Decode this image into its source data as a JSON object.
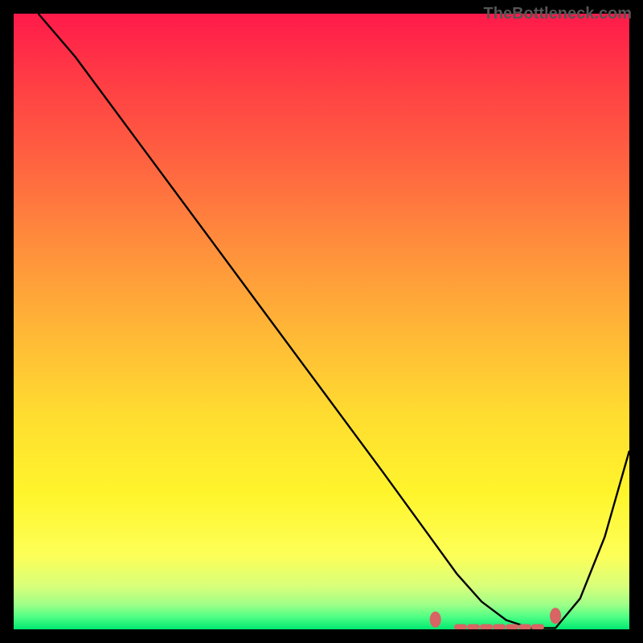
{
  "watermark": "TheBottleneck.com",
  "chart_data": {
    "type": "line",
    "title": "",
    "xlabel": "",
    "ylabel": "",
    "xlim": [
      0,
      100
    ],
    "ylim": [
      0,
      100
    ],
    "series": [
      {
        "name": "curve",
        "type": "line",
        "stroke": "#000000",
        "x": [
          4,
          10,
          20,
          30,
          40,
          50,
          60,
          64,
          68,
          72,
          76,
          80,
          84,
          88,
          92,
          96,
          100
        ],
        "values": [
          100,
          93,
          79.5,
          66,
          52.5,
          39,
          25.5,
          20,
          14.5,
          9,
          4.5,
          1.5,
          0.2,
          0.2,
          5,
          15,
          29
        ]
      },
      {
        "name": "markers-left",
        "type": "scatter",
        "color": "#d86464",
        "x": [
          68.5
        ],
        "values": [
          1.6
        ]
      },
      {
        "name": "markers-right",
        "type": "scatter",
        "color": "#d86464",
        "x": [
          88.0
        ],
        "values": [
          2.2
        ]
      },
      {
        "name": "dash-band",
        "type": "line",
        "stroke": "#d86464",
        "dash": true,
        "x": [
          72,
          86
        ],
        "values": [
          0.4,
          0.4
        ]
      }
    ]
  }
}
